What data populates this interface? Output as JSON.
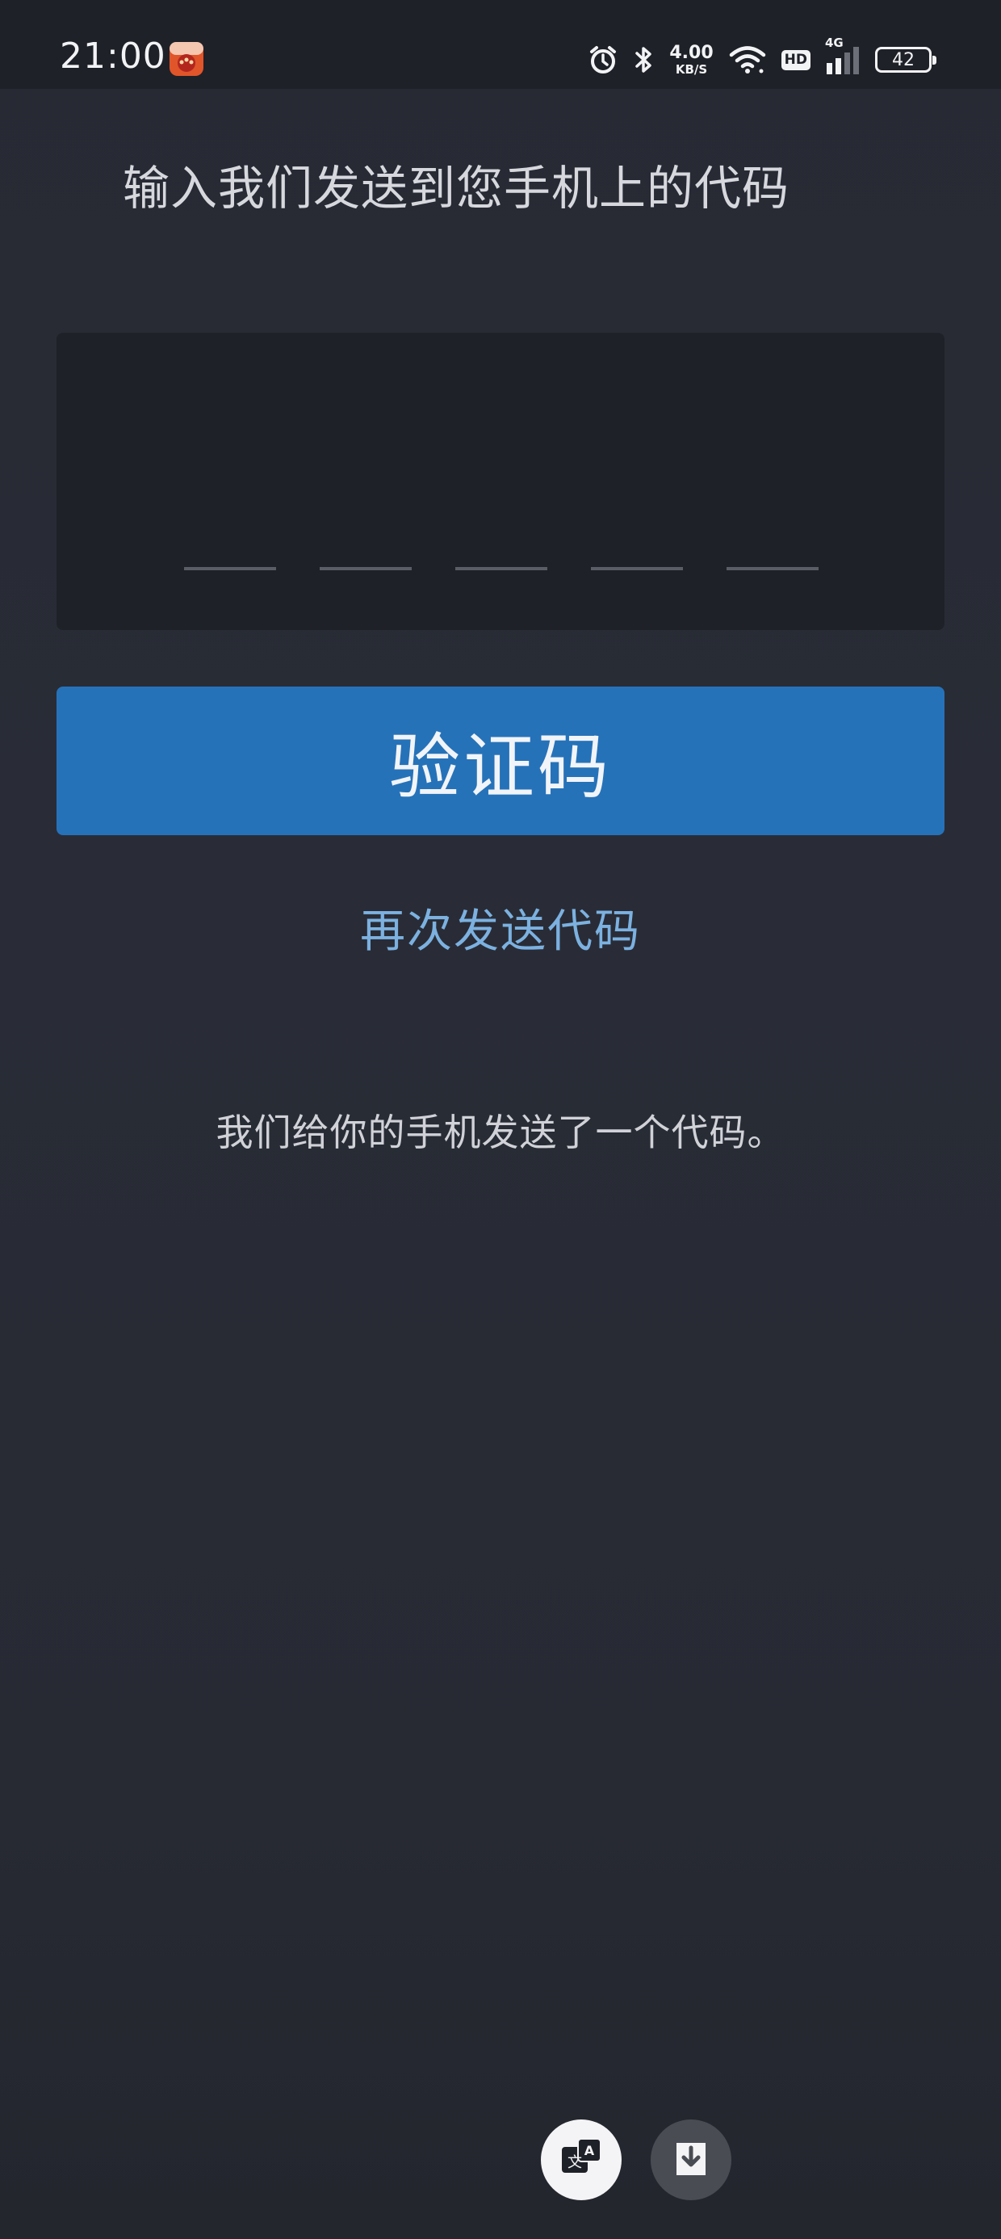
{
  "status_bar": {
    "time": "21:00",
    "net_speed_value": "4.00",
    "net_speed_unit": "KB/S",
    "hd_label": "HD",
    "signal_label": "4G",
    "battery_level": "42",
    "icons": [
      "alarm-icon",
      "bluetooth-icon",
      "wifi-icon",
      "signal-icon",
      "battery-icon"
    ]
  },
  "page": {
    "title": "输入我们发送到您手机上的代码",
    "code_slots": 5,
    "verify_button_label": "验证码",
    "resend_link_label": "再次发送代码",
    "info_text": "我们给你的手机发送了一个代码。"
  },
  "floating_actions": {
    "translate_icon": "translate-icon",
    "download_icon": "download-icon"
  },
  "colors": {
    "background": "#272a33",
    "panel": "#1f2128",
    "button": "#2672b9",
    "link": "#7cb1e0"
  }
}
